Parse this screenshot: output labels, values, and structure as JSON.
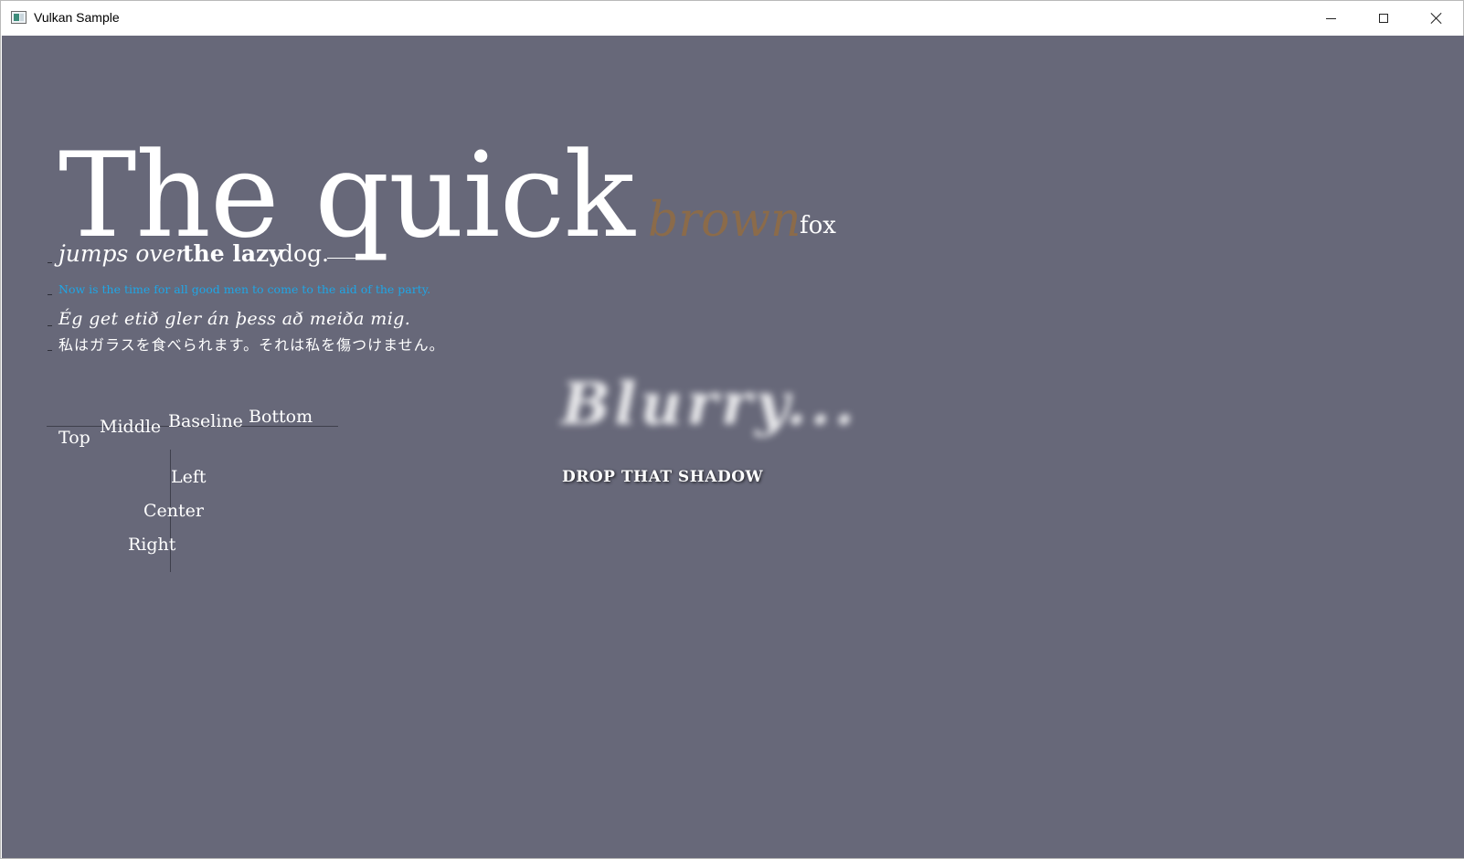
{
  "window": {
    "title": "Vulkan Sample",
    "controls": [
      "minimize",
      "maximize",
      "close"
    ]
  },
  "colors": {
    "background": "#676879",
    "text": "#ffffff",
    "brown": "#8b6b4a",
    "blue": "#1fa6e6",
    "guide_lines": "#3e3f4c"
  },
  "canvas": {
    "heading": {
      "the_quick": "The quick",
      "brown": "brown",
      "fox": "fox"
    },
    "line2": {
      "jumps_over": "jumps over",
      "the_lazy": "the lazy",
      "dog": "dog."
    },
    "now_line": "Now is the time for all good men to come to the aid of the party.",
    "icelandic": "Ég get etið gler án þess að meiða mig.",
    "japanese": "私はガラスを食べられます。それは私を傷つけません。",
    "vertical_align": {
      "top": "Top",
      "middle": "Middle",
      "baseline": "Baseline",
      "bottom": "Bottom"
    },
    "horizontal_align": {
      "left": "Left",
      "center": "Center",
      "right": "Right"
    },
    "blurry": "Blurry...",
    "drop_shadow": "DROP THAT SHADOW"
  }
}
